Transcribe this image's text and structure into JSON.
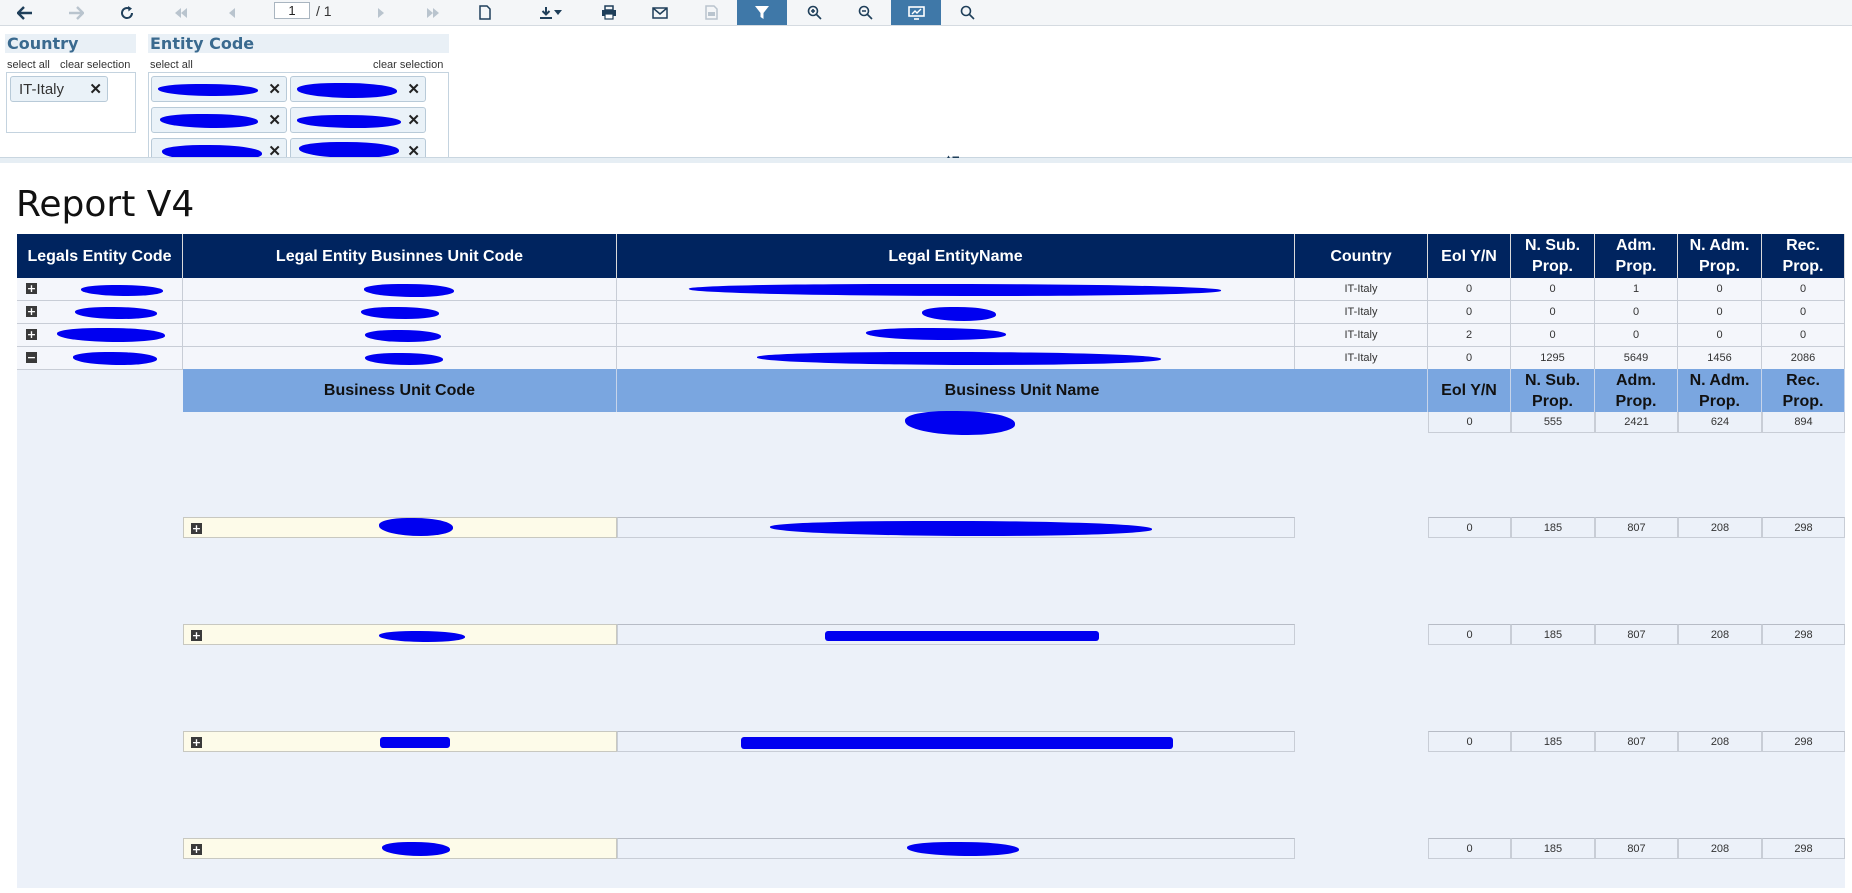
{
  "toolbar": {
    "page_current": "1",
    "page_total": "/ 1"
  },
  "filters": {
    "country": {
      "title": "Country",
      "select_all": "select all",
      "clear_selection": "clear selection",
      "chips": [
        "IT-Italy"
      ]
    },
    "entity_code": {
      "title": "Entity Code",
      "select_all": "select all",
      "clear_selection": "clear selection"
    }
  },
  "report": {
    "title": "Report V4",
    "headers": {
      "entity_code": "Legals Entity Code",
      "bu_code": "Legal Entity Businnes Unit Code",
      "name": "Legal EntityName",
      "country": "Country",
      "eol": "Eol Y/N",
      "nsub1": "N. Sub.",
      "nsub2": "Prop.",
      "adm1": "Adm.",
      "adm2": "Prop.",
      "nadm1": "N. Adm.",
      "nadm2": "Prop.",
      "rec1": "Rec.",
      "rec2": "Prop."
    },
    "rows": [
      {
        "expander": "+",
        "country": "IT-Italy",
        "eol": "0",
        "nsub": "0",
        "adm": "1",
        "nadm": "0",
        "rec": "0"
      },
      {
        "expander": "+",
        "country": "IT-Italy",
        "eol": "0",
        "nsub": "0",
        "adm": "0",
        "nadm": "0",
        "rec": "0"
      },
      {
        "expander": "+",
        "country": "IT-Italy",
        "eol": "2",
        "nsub": "0",
        "adm": "0",
        "nadm": "0",
        "rec": "0"
      },
      {
        "expander": "−",
        "country": "IT-Italy",
        "eol": "0",
        "nsub": "1295",
        "adm": "5649",
        "nadm": "1456",
        "rec": "2086"
      }
    ],
    "sub_headers": {
      "bu_code": "Business Unit Code",
      "bu_name": "Business Unit Name",
      "eol": "Eol Y/N",
      "nsub1": "N. Sub.",
      "nsub2": "Prop.",
      "adm1": "Adm.",
      "adm2": "Prop.",
      "nadm1": "N. Adm.",
      "nadm2": "Prop.",
      "rec1": "Rec.",
      "rec2": "Prop."
    },
    "sub_rows": [
      {
        "eol": "0",
        "nsub": "555",
        "adm": "2421",
        "nadm": "624",
        "rec": "894"
      },
      {
        "expander": "+",
        "eol": "0",
        "nsub": "185",
        "adm": "807",
        "nadm": "208",
        "rec": "298"
      },
      {
        "expander": "+",
        "eol": "0",
        "nsub": "185",
        "adm": "807",
        "nadm": "208",
        "rec": "298"
      },
      {
        "expander": "+",
        "eol": "0",
        "nsub": "185",
        "adm": "807",
        "nadm": "208",
        "rec": "298"
      },
      {
        "expander": "+",
        "eol": "0",
        "nsub": "185",
        "adm": "807",
        "nadm": "208",
        "rec": "298"
      }
    ]
  },
  "icons": [
    "back-icon",
    "forward-icon",
    "refresh-icon",
    "first-page-icon",
    "prev-page-icon",
    "next-page-icon",
    "last-page-icon",
    "document-icon",
    "download-icon",
    "print-icon",
    "email-icon",
    "save-icon",
    "filter-icon",
    "zoom-in-icon",
    "zoom-out-icon",
    "presentation-icon",
    "search-icon"
  ],
  "colors": {
    "header_bg": "#00245f",
    "sub_header_bg": "#7aa6e0",
    "redaction": "#0000f0"
  }
}
